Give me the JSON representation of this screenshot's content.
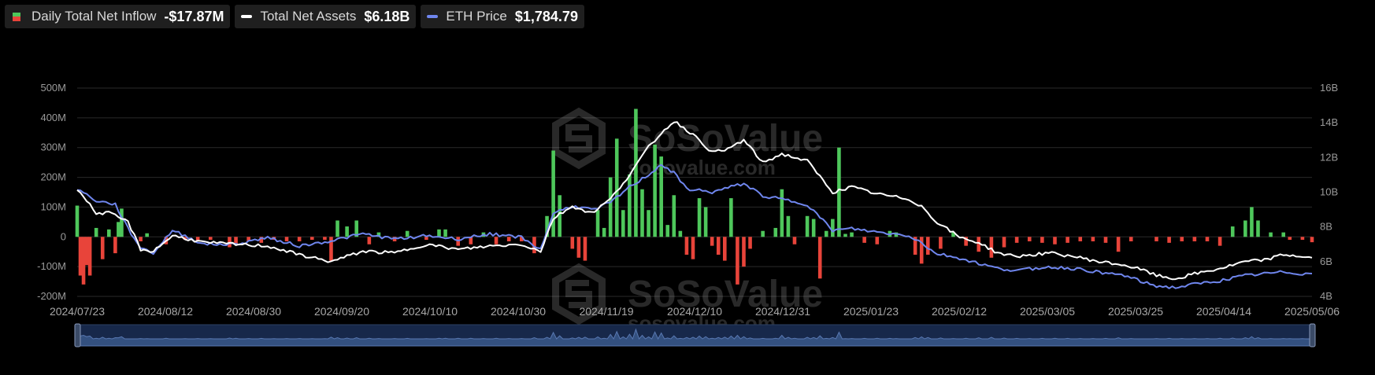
{
  "legend": {
    "inflow": {
      "label": "Daily Total Net Inflow",
      "value": "-$17.87M",
      "pos_color": "#4ec75b",
      "neg_color": "#e8443a"
    },
    "assets": {
      "label": "Total Net Assets",
      "value": "$6.18B",
      "color": "#ffffff"
    },
    "eth": {
      "label": "ETH Price",
      "value": "$1,784.79",
      "color": "#6f86ee"
    }
  },
  "watermark": {
    "brand": "SoSoValue",
    "site": "sosovalue.com"
  },
  "chart_data": {
    "type": "bar",
    "x_tick_labels": [
      "2024/07/23",
      "2024/08/12",
      "2024/08/30",
      "2024/09/20",
      "2024/10/10",
      "2024/10/30",
      "2024/11/19",
      "2024/12/10",
      "2024/12/31",
      "2025/01/23",
      "2025/02/12",
      "2025/03/05",
      "2025/03/25",
      "2025/04/14",
      "2025/05/06"
    ],
    "y_left": {
      "ticks": [
        "500M",
        "400M",
        "300M",
        "200M",
        "100M",
        "0",
        "-100M",
        "-200M"
      ],
      "range": [
        -200,
        500
      ],
      "unit": "M"
    },
    "y_right": {
      "ticks": [
        "16B",
        "14B",
        "12B",
        "10B",
        "8B",
        "6B",
        "4B"
      ],
      "range": [
        4,
        16
      ],
      "unit": "B"
    },
    "grid": true,
    "series": [
      {
        "name": "Daily Total Net Inflow",
        "type": "bar",
        "keys": [
          [
            0,
            105
          ],
          [
            1,
            -130
          ],
          [
            2,
            -160
          ],
          [
            3,
            -95
          ],
          [
            4,
            -130
          ],
          [
            6,
            30
          ],
          [
            8,
            -75
          ],
          [
            10,
            25
          ],
          [
            12,
            -55
          ],
          [
            13,
            50
          ],
          [
            14,
            95
          ],
          [
            20,
            -15
          ],
          [
            22,
            12
          ],
          [
            28,
            -25
          ],
          [
            34,
            -10
          ],
          [
            38,
            -15
          ],
          [
            42,
            -10
          ],
          [
            48,
            -35
          ],
          [
            50,
            -25
          ],
          [
            54,
            -15
          ],
          [
            58,
            -20
          ],
          [
            62,
            -10
          ],
          [
            66,
            -15
          ],
          [
            70,
            -15
          ],
          [
            74,
            -10
          ],
          [
            78,
            -10
          ],
          [
            80,
            -80
          ],
          [
            82,
            55
          ],
          [
            85,
            35
          ],
          [
            88,
            55
          ],
          [
            92,
            -25
          ],
          [
            95,
            15
          ],
          [
            100,
            -15
          ],
          [
            104,
            20
          ],
          [
            110,
            -10
          ],
          [
            114,
            25
          ],
          [
            116,
            25
          ],
          [
            120,
            -30
          ],
          [
            124,
            -25
          ],
          [
            128,
            15
          ],
          [
            132,
            -25
          ],
          [
            136,
            -15
          ],
          [
            140,
            -15
          ],
          [
            144,
            -55
          ],
          [
            148,
            70
          ],
          [
            150,
            290
          ],
          [
            152,
            140
          ],
          [
            156,
            -40
          ],
          [
            158,
            -70
          ],
          [
            160,
            -80
          ],
          [
            164,
            90
          ],
          [
            166,
            30
          ],
          [
            168,
            200
          ],
          [
            170,
            330
          ],
          [
            172,
            90
          ],
          [
            174,
            210
          ],
          [
            176,
            430
          ],
          [
            178,
            160
          ],
          [
            180,
            90
          ],
          [
            182,
            310
          ],
          [
            184,
            270
          ],
          [
            186,
            40
          ],
          [
            188,
            140
          ],
          [
            190,
            20
          ],
          [
            192,
            -60
          ],
          [
            194,
            -75
          ],
          [
            196,
            130
          ],
          [
            198,
            100
          ],
          [
            200,
            -30
          ],
          [
            202,
            -60
          ],
          [
            204,
            -80
          ],
          [
            206,
            130
          ],
          [
            208,
            -160
          ],
          [
            210,
            -100
          ],
          [
            212,
            -40
          ],
          [
            216,
            20
          ],
          [
            220,
            30
          ],
          [
            222,
            160
          ],
          [
            224,
            70
          ],
          [
            226,
            -25
          ],
          [
            230,
            70
          ],
          [
            232,
            60
          ],
          [
            234,
            -140
          ],
          [
            236,
            20
          ],
          [
            238,
            60
          ],
          [
            240,
            300
          ],
          [
            242,
            10
          ],
          [
            244,
            15
          ],
          [
            248,
            -20
          ],
          [
            252,
            -25
          ],
          [
            256,
            20
          ],
          [
            258,
            15
          ],
          [
            264,
            -60
          ],
          [
            266,
            -90
          ],
          [
            268,
            -60
          ],
          [
            272,
            -40
          ],
          [
            276,
            15
          ],
          [
            280,
            -30
          ],
          [
            284,
            -50
          ],
          [
            288,
            -70
          ],
          [
            292,
            -35
          ],
          [
            296,
            -20
          ],
          [
            300,
            -15
          ],
          [
            304,
            -20
          ],
          [
            308,
            -25
          ],
          [
            312,
            -20
          ],
          [
            316,
            -15
          ],
          [
            320,
            -15
          ],
          [
            324,
            -20
          ],
          [
            328,
            -50
          ],
          [
            332,
            -15
          ],
          [
            340,
            -15
          ],
          [
            344,
            -20
          ],
          [
            348,
            -15
          ],
          [
            352,
            -15
          ],
          [
            356,
            -15
          ],
          [
            360,
            -30
          ],
          [
            364,
            35
          ],
          [
            368,
            55
          ],
          [
            370,
            100
          ],
          [
            372,
            55
          ],
          [
            376,
            15
          ],
          [
            380,
            15
          ],
          [
            382,
            -10
          ],
          [
            386,
            -10
          ],
          [
            389,
            -18
          ]
        ]
      },
      {
        "name": "Total Net Assets",
        "type": "line",
        "axis": "right",
        "keys": [
          [
            0,
            10.2
          ],
          [
            6,
            8.8
          ],
          [
            10,
            8.8
          ],
          [
            16,
            8.3
          ],
          [
            20,
            6.7
          ],
          [
            24,
            6.6
          ],
          [
            30,
            7.5
          ],
          [
            40,
            7.1
          ],
          [
            50,
            7.0
          ],
          [
            60,
            6.9
          ],
          [
            70,
            6.4
          ],
          [
            80,
            6.0
          ],
          [
            90,
            6.6
          ],
          [
            100,
            6.5
          ],
          [
            110,
            7.0
          ],
          [
            120,
            6.7
          ],
          [
            130,
            6.9
          ],
          [
            140,
            7.0
          ],
          [
            146,
            6.6
          ],
          [
            150,
            8.5
          ],
          [
            156,
            9.2
          ],
          [
            162,
            8.8
          ],
          [
            168,
            9.6
          ],
          [
            174,
            11.0
          ],
          [
            180,
            12.6
          ],
          [
            184,
            13.4
          ],
          [
            188,
            14.1
          ],
          [
            192,
            13.6
          ],
          [
            196,
            13.0
          ],
          [
            200,
            12.3
          ],
          [
            204,
            12.4
          ],
          [
            210,
            13.0
          ],
          [
            216,
            11.7
          ],
          [
            222,
            12.2
          ],
          [
            230,
            11.8
          ],
          [
            238,
            10.0
          ],
          [
            244,
            10.3
          ],
          [
            252,
            9.9
          ],
          [
            262,
            9.6
          ],
          [
            266,
            9.2
          ],
          [
            270,
            8.4
          ],
          [
            278,
            7.4
          ],
          [
            284,
            7.1
          ],
          [
            290,
            6.5
          ],
          [
            296,
            6.3
          ],
          [
            306,
            6.5
          ],
          [
            314,
            6.3
          ],
          [
            322,
            6.0
          ],
          [
            330,
            5.8
          ],
          [
            336,
            5.5
          ],
          [
            340,
            5.2
          ],
          [
            346,
            5.0
          ],
          [
            352,
            5.3
          ],
          [
            360,
            5.6
          ],
          [
            368,
            6.0
          ],
          [
            374,
            6.1
          ],
          [
            380,
            6.4
          ],
          [
            386,
            6.3
          ],
          [
            389,
            6.2
          ]
        ]
      },
      {
        "name": "ETH Price",
        "type": "line",
        "axis": "right",
        "keys": [
          [
            0,
            10.2
          ],
          [
            6,
            9.5
          ],
          [
            12,
            9.3
          ],
          [
            16,
            7.9
          ],
          [
            20,
            6.8
          ],
          [
            24,
            6.5
          ],
          [
            30,
            7.8
          ],
          [
            40,
            7.0
          ],
          [
            50,
            7.0
          ],
          [
            60,
            7.4
          ],
          [
            70,
            6.9
          ],
          [
            80,
            7.2
          ],
          [
            90,
            7.6
          ],
          [
            100,
            7.3
          ],
          [
            110,
            7.5
          ],
          [
            120,
            7.3
          ],
          [
            130,
            7.6
          ],
          [
            140,
            7.4
          ],
          [
            146,
            6.7
          ],
          [
            150,
            8.8
          ],
          [
            156,
            9.2
          ],
          [
            162,
            9.0
          ],
          [
            168,
            9.4
          ],
          [
            174,
            10.3
          ],
          [
            180,
            11.0
          ],
          [
            184,
            11.6
          ],
          [
            188,
            11.1
          ],
          [
            192,
            10.2
          ],
          [
            196,
            10.1
          ],
          [
            200,
            10.0
          ],
          [
            204,
            10.2
          ],
          [
            210,
            10.5
          ],
          [
            216,
            9.8
          ],
          [
            222,
            9.6
          ],
          [
            230,
            9.3
          ],
          [
            238,
            7.8
          ],
          [
            244,
            7.9
          ],
          [
            252,
            7.7
          ],
          [
            262,
            7.5
          ],
          [
            266,
            7.1
          ],
          [
            270,
            6.5
          ],
          [
            278,
            6.2
          ],
          [
            284,
            5.9
          ],
          [
            290,
            5.6
          ],
          [
            296,
            5.5
          ],
          [
            306,
            5.7
          ],
          [
            314,
            5.6
          ],
          [
            322,
            5.4
          ],
          [
            330,
            5.2
          ],
          [
            336,
            4.8
          ],
          [
            340,
            4.6
          ],
          [
            346,
            4.5
          ],
          [
            352,
            4.7
          ],
          [
            360,
            4.9
          ],
          [
            368,
            5.2
          ],
          [
            374,
            5.3
          ],
          [
            380,
            5.4
          ],
          [
            386,
            5.3
          ],
          [
            389,
            5.3
          ]
        ]
      }
    ]
  }
}
